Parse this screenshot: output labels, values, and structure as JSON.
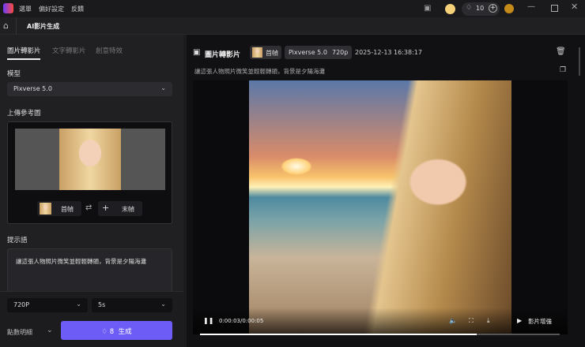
{
  "menu": {
    "items": [
      "選單",
      "偏好設定",
      "反饋"
    ]
  },
  "topbar": {
    "credits": "10"
  },
  "header": {
    "title": "AI影片生成"
  },
  "left": {
    "tabs": [
      "圖片轉影片",
      "文字轉影片",
      "創意特效"
    ],
    "model_label": "模型",
    "model_value": "Pixverse 5.0",
    "upload_label": "上傳參考圖",
    "first_frame": "首幀",
    "last_frame": "末幀",
    "prompt_label": "提示語",
    "prompt_text": "讓這張人物照片微笑並輕輕轉頭，背景是夕陽海灘",
    "resolution": "720P",
    "duration": "5s",
    "points_detail": "點數明細",
    "generate_cost": "8",
    "generate_label": "生成"
  },
  "task": {
    "title": "圖片轉影片",
    "frame": "首幀",
    "model": "Pixverse 5.0",
    "resolution": "720p",
    "timestamp": "2025-12-13 16:38:17",
    "prompt": "讓這張人物照片微笑並輕輕轉頭，背景是夕陽海灘"
  },
  "player": {
    "time": "0:00:03/0:00:05",
    "progress": 0.77,
    "enhance_label": "影片增強"
  }
}
